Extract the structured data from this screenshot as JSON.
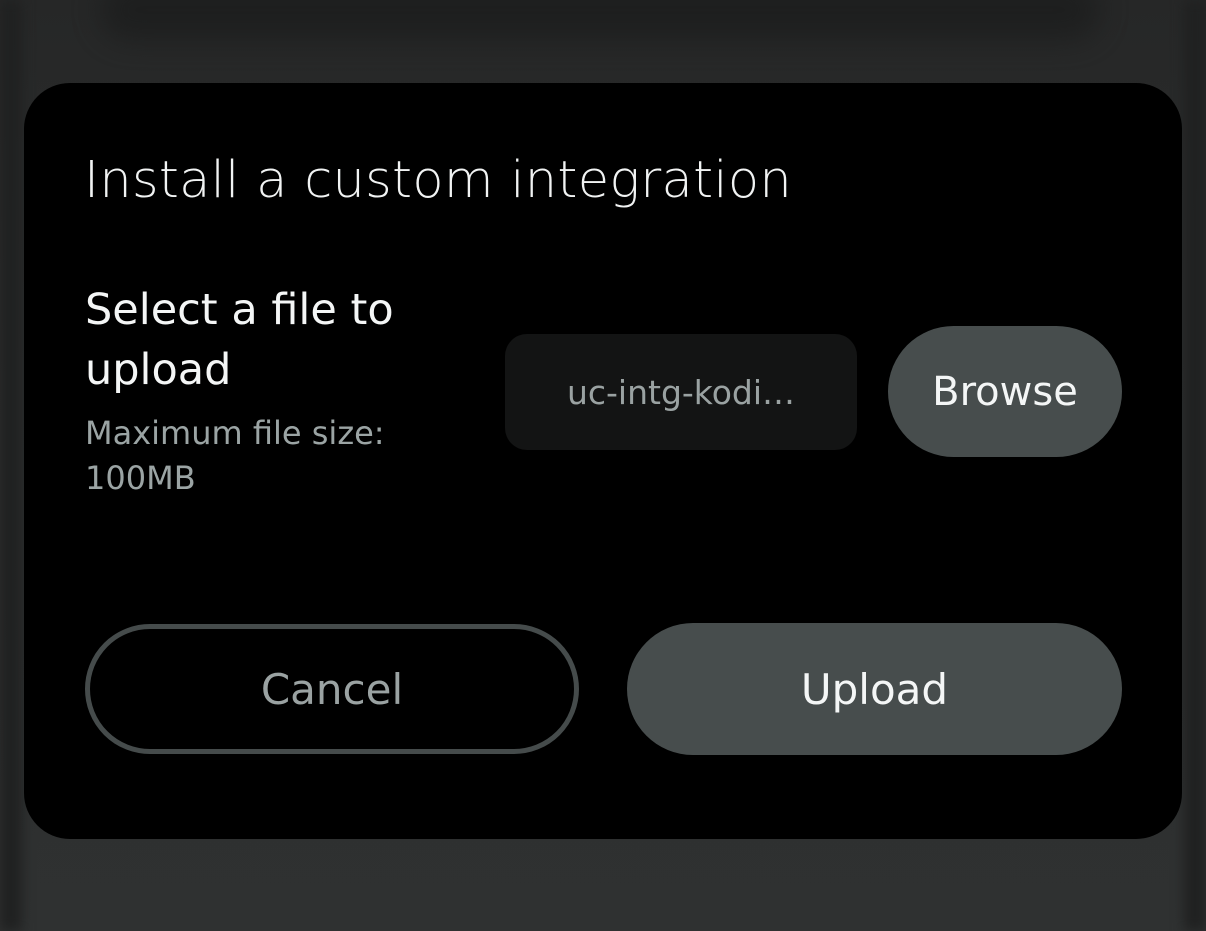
{
  "dialog": {
    "title": "Install a custom integration",
    "file_label": "Select a file to upload",
    "size_hint": "Maximum file size: 100MB",
    "file_field": {
      "value": "uc-intg-kodi…"
    },
    "browse_label": "Browse",
    "cancel_label": "Cancel",
    "upload_label": "Upload"
  },
  "colors": {
    "dialog_background": "#000000",
    "button_fill": "#474d4d",
    "outline": "#454b4b",
    "muted_text": "#9aa2a2",
    "primary_text": "#f4f6f6"
  }
}
